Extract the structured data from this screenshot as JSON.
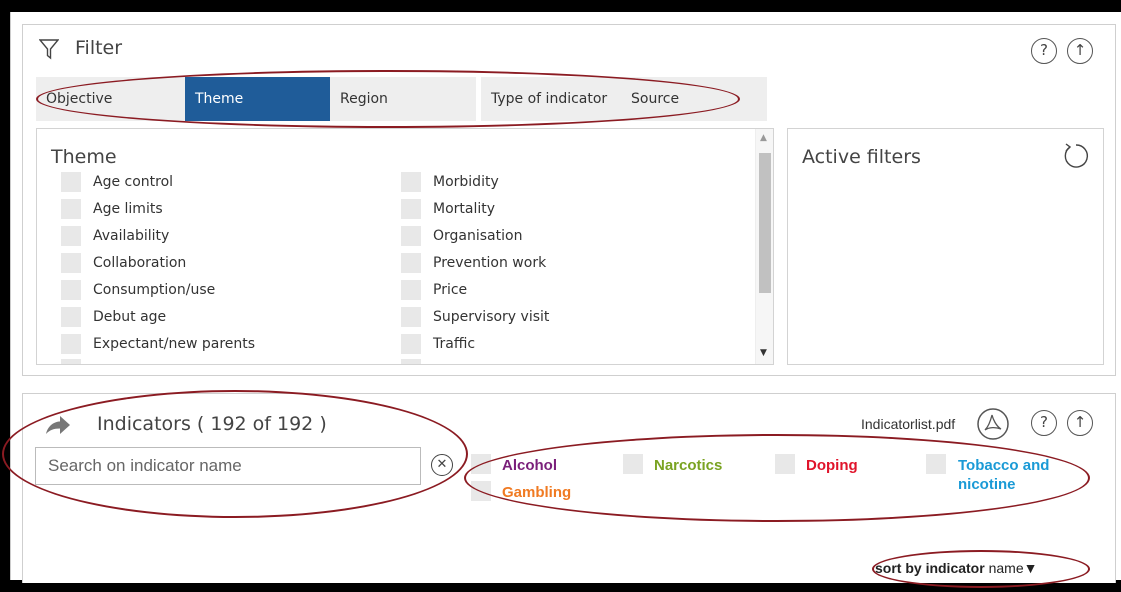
{
  "filter": {
    "title": "Filter",
    "help": "?",
    "up": "↑",
    "tabs": [
      {
        "label": "Objective",
        "active": false
      },
      {
        "label": "Theme",
        "active": true
      },
      {
        "label": "Region",
        "active": false
      },
      {
        "label": "Type of indicator",
        "active": false
      },
      {
        "label": "Source",
        "active": false
      }
    ],
    "theme": {
      "title": "Theme",
      "col1": [
        "Age control",
        "Age limits",
        "Availability",
        "Collaboration",
        "Consumption/use",
        "Debut age",
        "Expectant/new parents"
      ],
      "col2": [
        "Morbidity",
        "Mortality",
        "Organisation",
        "Prevention work",
        "Price",
        "Supervisory visit",
        "Traffic"
      ]
    },
    "active_filters": {
      "title": "Active filters",
      "reset_icon": "↻"
    }
  },
  "indicators": {
    "title": "Indicators ( 192 of 192 )",
    "pdf_label": "Indicatorlist.pdf",
    "help": "?",
    "up": "↑",
    "search_placeholder": "Search on indicator name",
    "clear": "✕",
    "categories": [
      {
        "label": "Alcohol",
        "color": "#7a1f7a"
      },
      {
        "label": "Narcotics",
        "color": "#7aa322"
      },
      {
        "label": "Doping",
        "color": "#e0142b"
      },
      {
        "label": "Tobacco and\nnicotine",
        "color": "#1a9ad6"
      },
      {
        "label": "Gambling",
        "color": "#f07a22"
      }
    ],
    "sort": {
      "bold": "sort by indicator",
      "rest": "name▼"
    }
  },
  "colors": {
    "accent": "#1f5c99",
    "annotation": "#8b1b22"
  }
}
